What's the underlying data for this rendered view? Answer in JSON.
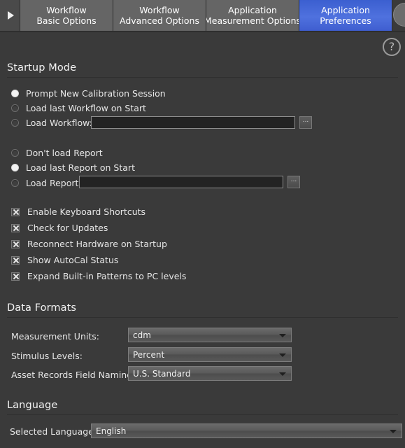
{
  "tabbar": {
    "nav_arrow_icon": "play-right-icon",
    "tabs": [
      {
        "line1": "Workflow",
        "line2": "Basic Options",
        "active": false
      },
      {
        "line1": "Workflow",
        "line2": "Advanced Options",
        "active": false
      },
      {
        "line1": "Application",
        "line2": "Measurement Options",
        "active": false
      },
      {
        "line1": "Application",
        "line2": "Preferences",
        "active": true
      }
    ],
    "active_tab_color": "#4f71de",
    "inactive_tab_color": "#656565"
  },
  "help": {
    "icon": "question-mark-icon",
    "glyph": "?"
  },
  "startup_mode": {
    "heading": "Startup Mode",
    "workflow_options": [
      {
        "label": "Prompt New Calibration Session",
        "selected": true
      },
      {
        "label": "Load last Workflow on Start",
        "selected": false
      },
      {
        "label": "Load Workflow:",
        "selected": false
      }
    ],
    "workflow_path": {
      "value": "",
      "placeholder": ""
    },
    "workflow_browse_label": "...",
    "report_options": [
      {
        "label": "Don't load Report",
        "selected": false
      },
      {
        "label": "Load last Report on Start",
        "selected": true
      },
      {
        "label": "Load Report:",
        "selected": false
      }
    ],
    "report_path": {
      "value": "",
      "placeholder": ""
    },
    "report_browse_label": "...",
    "checkboxes": [
      {
        "label": "Enable Keyboard Shortcuts",
        "checked": true
      },
      {
        "label": "Check for Updates",
        "checked": true
      },
      {
        "label": "Reconnect Hardware on Startup",
        "checked": true
      },
      {
        "label": "Show AutoCal Status",
        "checked": true
      },
      {
        "label": "Expand Built-in Patterns to PC levels",
        "checked": true
      }
    ]
  },
  "data_formats": {
    "heading": "Data Formats",
    "rows": [
      {
        "label": "Measurement Units:",
        "value": "cdm"
      },
      {
        "label": "Stimulus Levels:",
        "value": "Percent"
      },
      {
        "label": "Asset Records Field Naming:",
        "value": "U.S. Standard"
      }
    ]
  },
  "language": {
    "heading": "Language",
    "label": "Selected Language",
    "value": "English"
  },
  "colors": {
    "background": "#3a3a3a",
    "accent_blue": "#4f71de",
    "text": "#e6e6e6",
    "field_background": "#232323"
  }
}
